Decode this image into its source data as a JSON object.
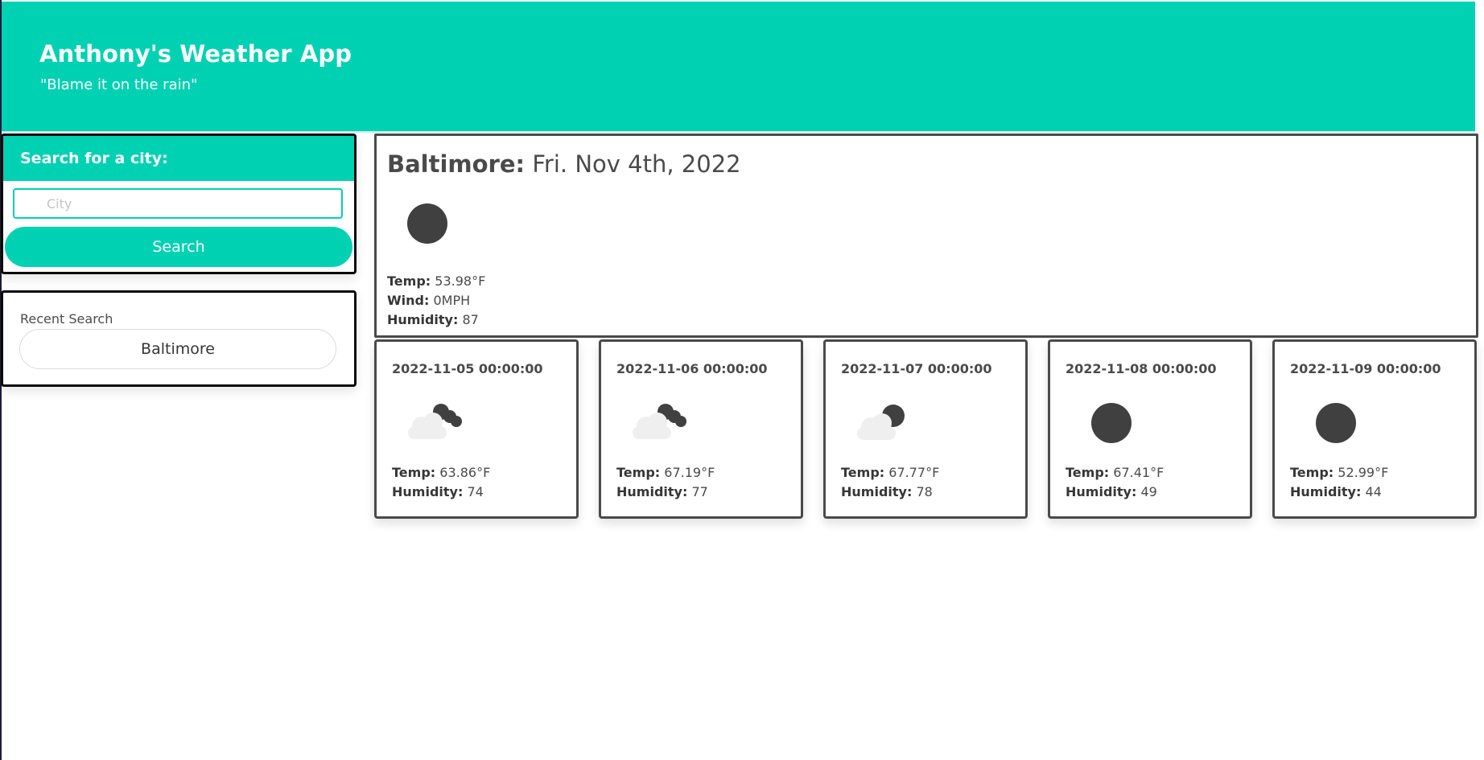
{
  "header": {
    "title": "Anthony's Weather App",
    "subtitle": "\"Blame it on the rain\""
  },
  "search": {
    "heading": "Search for a city:",
    "placeholder": "City",
    "button_label": "Search"
  },
  "recent": {
    "label": "Recent Search",
    "items": [
      "Baltimore"
    ]
  },
  "current": {
    "city": "Baltimore:",
    "date": "Fri. Nov 4th, 2022",
    "icon": "full-moon-icon",
    "temp_label": "Temp:",
    "temp_value": "53.98°F",
    "wind_label": "Wind:",
    "wind_value": "0MPH",
    "humidity_label": "Humidity:",
    "humidity_value": "87"
  },
  "forecast": [
    {
      "date": "2022-11-05 00:00:00",
      "icon": "broken-clouds-night-icon",
      "temp_label": "Temp:",
      "temp": "63.86°F",
      "humidity_label": "Humidity:",
      "humidity": "74"
    },
    {
      "date": "2022-11-06 00:00:00",
      "icon": "broken-clouds-night-icon",
      "temp_label": "Temp:",
      "temp": "67.19°F",
      "humidity_label": "Humidity:",
      "humidity": "77"
    },
    {
      "date": "2022-11-07 00:00:00",
      "icon": "few-clouds-night-icon",
      "temp_label": "Temp:",
      "temp": "67.77°F",
      "humidity_label": "Humidity:",
      "humidity": "78"
    },
    {
      "date": "2022-11-08 00:00:00",
      "icon": "full-moon-icon",
      "temp_label": "Temp:",
      "temp": "67.41°F",
      "humidity_label": "Humidity:",
      "humidity": "49"
    },
    {
      "date": "2022-11-09 00:00:00",
      "icon": "full-moon-icon",
      "temp_label": "Temp:",
      "temp": "52.99°F",
      "humidity_label": "Humidity:",
      "humidity": "44"
    }
  ],
  "colors": {
    "accent": "#00d1b2",
    "border": "#4a4a4a",
    "text": "#4a4a4a"
  }
}
